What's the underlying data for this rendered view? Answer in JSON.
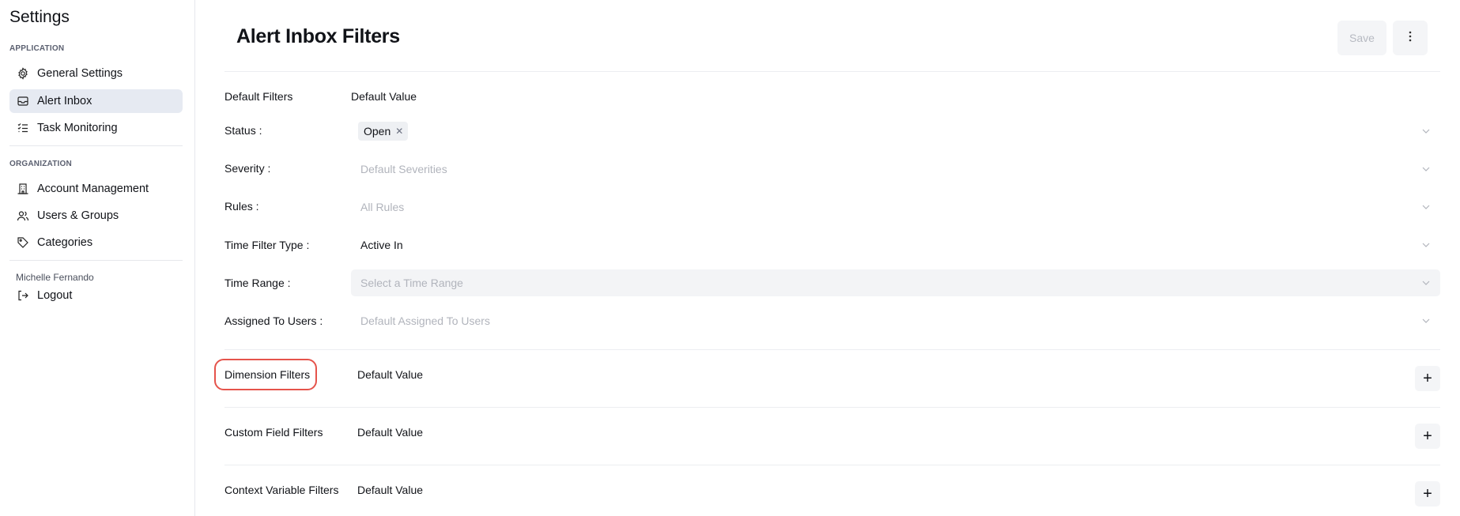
{
  "sidebar": {
    "title": "Settings",
    "sections": {
      "application": "APPLICATION",
      "organization": "ORGANIZATION"
    },
    "items": [
      {
        "label": "General Settings",
        "icon": "gear-icon"
      },
      {
        "label": "Alert Inbox",
        "icon": "inbox-icon",
        "active": true
      },
      {
        "label": "Task Monitoring",
        "icon": "list-check-icon"
      },
      {
        "label": "Account Management",
        "icon": "building-icon"
      },
      {
        "label": "Users & Groups",
        "icon": "users-icon"
      },
      {
        "label": "Categories",
        "icon": "tag-icon"
      }
    ],
    "user_name": "Michelle Fernando",
    "logout_label": "Logout"
  },
  "header": {
    "title": "Alert Inbox Filters",
    "save_label": "Save"
  },
  "default_filters": {
    "section_label": "Default Filters",
    "value_header": "Default Value",
    "rows": [
      {
        "label": "Status",
        "value": "",
        "placeholder": "",
        "tags": [
          "Open"
        ]
      },
      {
        "label": "Severity",
        "value": "",
        "placeholder": "Default Severities"
      },
      {
        "label": "Rules",
        "value": "",
        "placeholder": "All Rules"
      },
      {
        "label": "Time Filter Type",
        "value": "Active In",
        "placeholder": ""
      },
      {
        "label": "Time Range",
        "value": "",
        "placeholder": "Select a Time Range"
      },
      {
        "label": "Assigned To Users",
        "value": "",
        "placeholder": "Default Assigned To Users"
      }
    ]
  },
  "sections": [
    {
      "label": "Dimension Filters",
      "value_header": "Default Value"
    },
    {
      "label": "Custom Field Filters",
      "value_header": "Default Value"
    },
    {
      "label": "Context Variable Filters",
      "value_header": "Default Value"
    }
  ],
  "colors": {
    "accent_highlight": "#e5534b",
    "active_item_bg": "#e6eaf2",
    "placeholder": "#b1b4bc"
  }
}
